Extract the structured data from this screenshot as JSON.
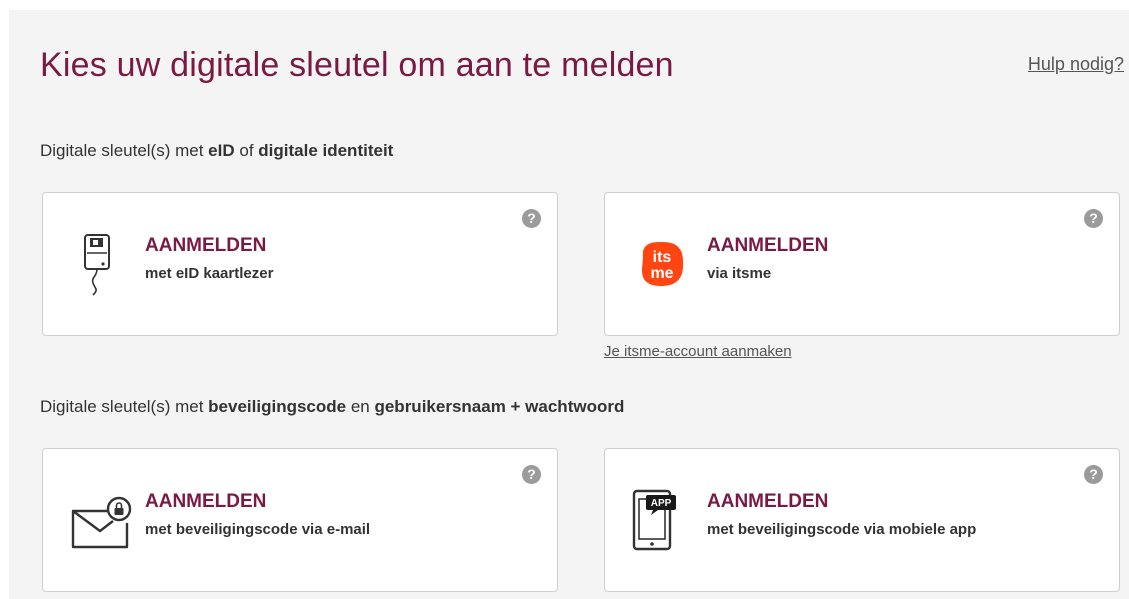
{
  "header": {
    "title": "Kies uw digitale sleutel om aan te melden",
    "help_link": "Hulp nodig?"
  },
  "section1": {
    "prefix": "Digitale sleutel(s) met ",
    "bold1": "eID",
    "mid": " of ",
    "bold2": "digitale identiteit"
  },
  "section2": {
    "prefix": "Digitale sleutel(s) met ",
    "bold1": "beveiligingscode",
    "mid": " en ",
    "bold2": "gebruikersnaam + wachtwoord"
  },
  "cards": [
    {
      "title": "AANMELDEN",
      "subtitle": "met eID kaartlezer",
      "icon": "card-reader-icon",
      "help": "?"
    },
    {
      "title": "AANMELDEN",
      "subtitle": "via itsme",
      "icon": "itsme-logo",
      "help": "?"
    },
    {
      "title": "AANMELDEN",
      "subtitle": "met beveiligingscode via e-mail",
      "icon": "envelope-lock-icon",
      "help": "?"
    },
    {
      "title": "AANMELDEN",
      "subtitle": "met beveiligingscode via mobiele app",
      "icon": "mobile-app-icon",
      "help": "?"
    }
  ],
  "itsme": {
    "account_link": "Je itsme-account aanmaken",
    "logo_text_top": "its",
    "logo_text_bottom": "me",
    "logo_color": "#ff4612"
  },
  "app_badge": "APP",
  "colors": {
    "accent": "#7a1a43",
    "panel_bg": "#f4f4f4",
    "help_icon": "#9b9b9b"
  }
}
